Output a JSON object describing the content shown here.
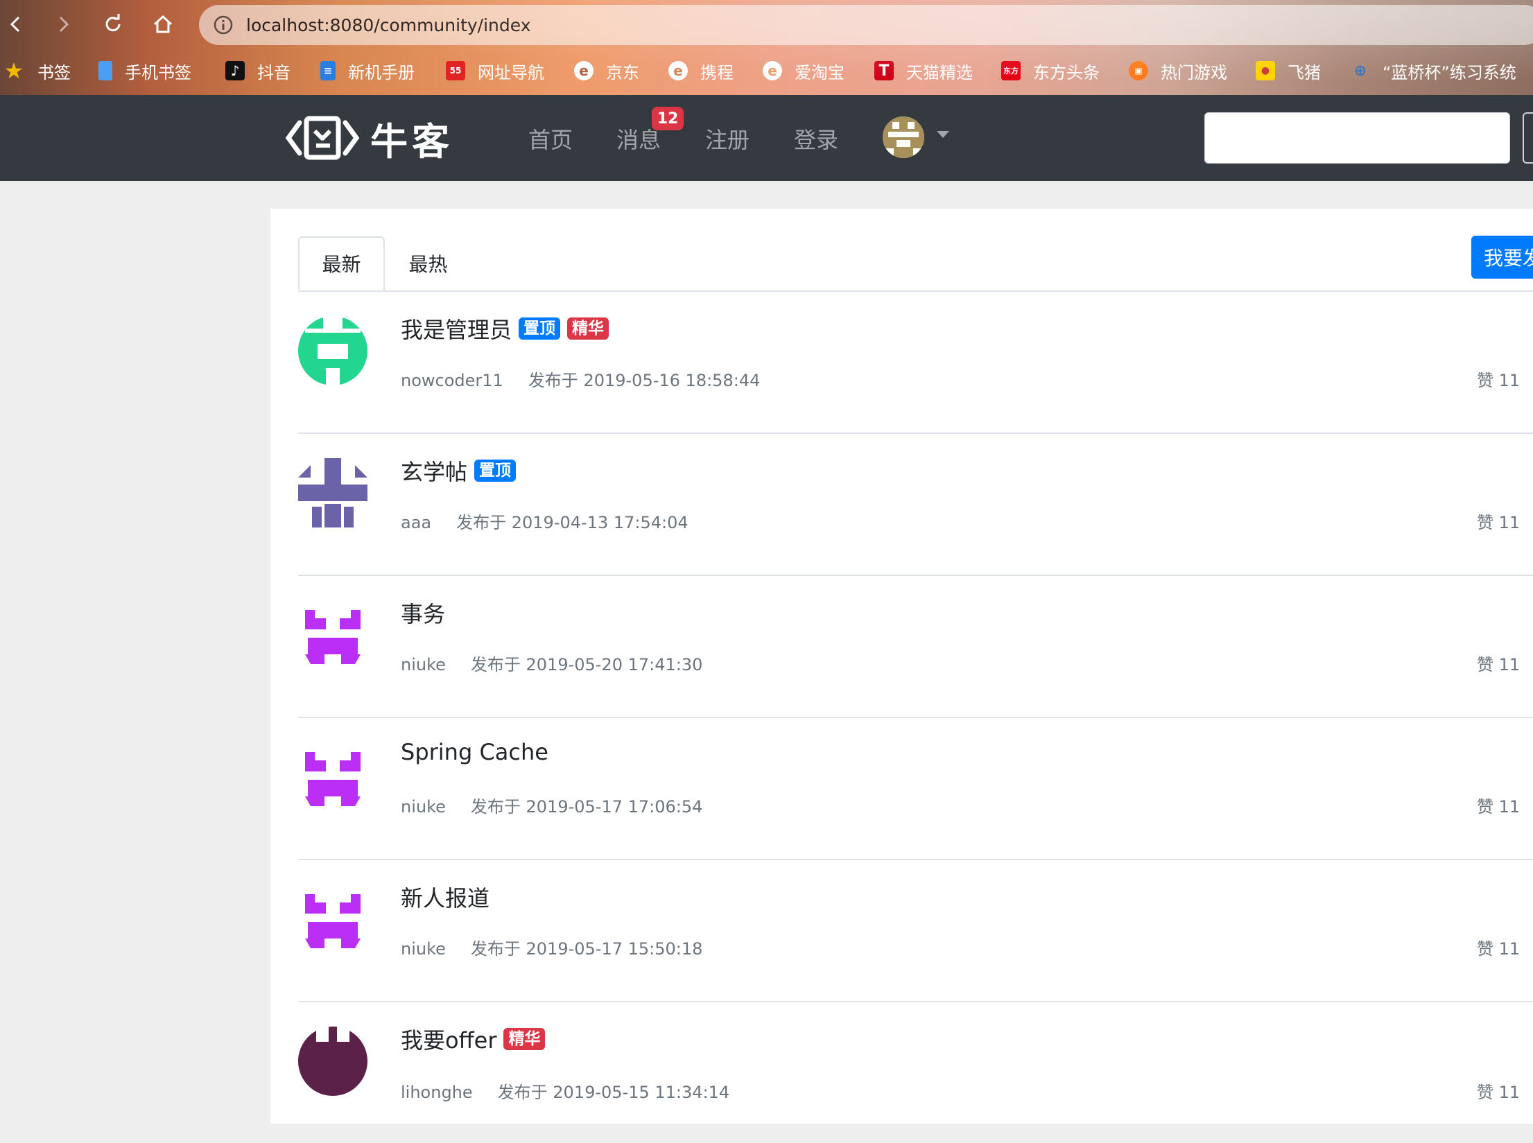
{
  "browser": {
    "url": "localhost:8080/community/index",
    "bookmarks": [
      {
        "label": "书签",
        "icon": "star-icon",
        "color": "#f5b800"
      },
      {
        "label": "手机书签",
        "icon": "phone-icon",
        "color": "#4a9ff5"
      },
      {
        "label": "抖音",
        "icon": "tiktok-icon",
        "color": "#111111"
      },
      {
        "label": "新机手册",
        "icon": "manual-icon",
        "color": "#2a7de1"
      },
      {
        "label": "网址导航",
        "icon": "nav-icon",
        "color": "#e02424"
      },
      {
        "label": "京东",
        "icon": "edge-icon",
        "color": "#ffffff"
      },
      {
        "label": "携程",
        "icon": "edge-icon",
        "color": "#ffffff"
      },
      {
        "label": "爱淘宝",
        "icon": "edge-icon",
        "color": "#ffffff"
      },
      {
        "label": "天猫精选",
        "icon": "tmall-icon",
        "color": "#d0021b"
      },
      {
        "label": "东方头条",
        "icon": "dongfang-icon",
        "color": "#e60012"
      },
      {
        "label": "热门游戏",
        "icon": "game-icon",
        "color": "#ff7a1a"
      },
      {
        "label": "飞猪",
        "icon": "fliggy-icon",
        "color": "#ffd200"
      },
      {
        "label": "“蓝桥杯”练习系统",
        "icon": "lanqiao-icon",
        "color": "#3a6fb5"
      }
    ]
  },
  "nav": {
    "brand": "牛客",
    "links": {
      "home": "首页",
      "messages": "消息",
      "register": "注册",
      "login": "登录"
    },
    "message_count": "12"
  },
  "tabs": {
    "latest": "最新",
    "hottest": "最热"
  },
  "post_button": "我要发布",
  "colors": {
    "primary": "#007bff",
    "danger": "#dc3545",
    "navbar": "#343a40"
  },
  "posts": [
    {
      "title": "我是管理员",
      "top": "置顶",
      "wonderful": "精华",
      "author": "nowcoder11",
      "time": "发布于 2019-05-16 18:58:44",
      "likes": "赞 11",
      "sep": "|",
      "avatar_color": "#22d68f"
    },
    {
      "title": "玄学帖",
      "top": "置顶",
      "author": "aaa",
      "time": "发布于 2019-04-13 17:54:04",
      "likes": "赞 11",
      "sep": "|",
      "avatar_color": "#6b63a8"
    },
    {
      "title": "事务",
      "author": "niuke",
      "time": "发布于 2019-05-20 17:41:30",
      "likes": "赞 11",
      "sep": "|",
      "avatar_color": "#bb2ef5"
    },
    {
      "title": "Spring Cache",
      "author": "niuke",
      "time": "发布于 2019-05-17 17:06:54",
      "likes": "赞 11",
      "sep": "|",
      "avatar_color": "#bb2ef5"
    },
    {
      "title": "新人报道",
      "author": "niuke",
      "time": "发布于 2019-05-17 15:50:18",
      "likes": "赞 11",
      "sep": "|",
      "avatar_color": "#bb2ef5"
    },
    {
      "title": "我要offer",
      "wonderful": "精华",
      "author": "lihonghe",
      "time": "发布于 2019-05-15 11:34:14",
      "likes": "赞 11",
      "sep": "|",
      "avatar_color": "#5c2149"
    }
  ]
}
